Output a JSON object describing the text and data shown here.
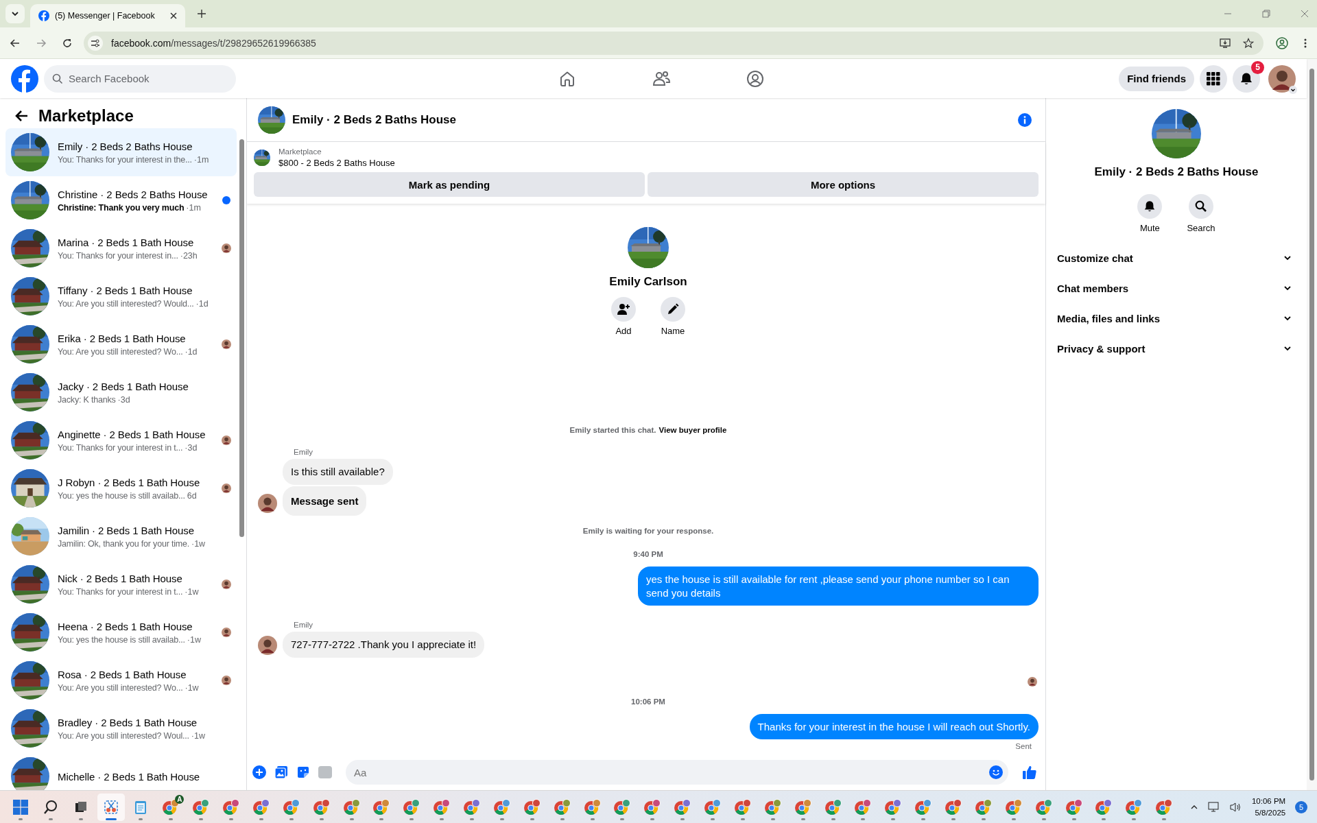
{
  "browser": {
    "tab_title": "(5) Messenger | Facebook",
    "url_host": "facebook.com",
    "url_path": "/messages/t/29829652619966385"
  },
  "topnav": {
    "search_placeholder": "Search Facebook",
    "find_friends": "Find friends",
    "notification_count": "5"
  },
  "sidebar": {
    "title": "Marketplace",
    "conversations": [
      {
        "title": "Emily · 2 Beds 2 Baths House",
        "preview": "You: Thanks for your interest in the...",
        "time": "·1m",
        "selected": true,
        "unread": false,
        "seen": false
      },
      {
        "title": "Christine · 2 Beds 2 Baths House",
        "preview": "Christine: Thank you very much",
        "time": "·1m",
        "selected": false,
        "unread": true,
        "seen": false
      },
      {
        "title": "Marina · 2 Beds 1 Bath House",
        "preview": "You: Thanks for your interest in...",
        "time": "·23h",
        "selected": false,
        "unread": false,
        "seen": true
      },
      {
        "title": "Tiffany · 2 Beds 1 Bath House",
        "preview": "You: Are you still interested? Would...",
        "time": "·1d",
        "selected": false,
        "unread": false,
        "seen": false
      },
      {
        "title": "Erika · 2 Beds 1 Bath House",
        "preview": "You: Are you still interested? Wo...",
        "time": "·1d",
        "selected": false,
        "unread": false,
        "seen": true
      },
      {
        "title": "Jacky · 2 Beds 1 Bath House",
        "preview": "Jacky: K thanks",
        "time": "·3d",
        "selected": false,
        "unread": false,
        "seen": false
      },
      {
        "title": "Anginette · 2 Beds 1 Bath House",
        "preview": "You: Thanks for your interest in t...",
        "time": "·3d",
        "selected": false,
        "unread": false,
        "seen": true
      },
      {
        "title": "J Robyn · 2 Beds 1 Bath House",
        "preview": "You: yes the house is still availab...",
        "time": "6d",
        "selected": false,
        "unread": false,
        "seen": true
      },
      {
        "title": "Jamilin · 2 Beds 1 Bath House",
        "preview": "Jamilin: Ok, thank you for your time.",
        "time": "·1w",
        "selected": false,
        "unread": false,
        "seen": false
      },
      {
        "title": "Nick · 2 Beds 1 Bath House",
        "preview": "You: Thanks for your interest in t...",
        "time": "·1w",
        "selected": false,
        "unread": false,
        "seen": true
      },
      {
        "title": "Heena · 2 Beds 1 Bath House",
        "preview": "You: yes the house is still availab...",
        "time": "·1w",
        "selected": false,
        "unread": false,
        "seen": true
      },
      {
        "title": "Rosa · 2 Beds 1 Bath House",
        "preview": "You: Are you still interested? Wo...",
        "time": "·1w",
        "selected": false,
        "unread": false,
        "seen": true
      },
      {
        "title": "Bradley · 2 Beds 1 Bath House",
        "preview": "You: Are you still interested? Woul...",
        "time": "·1w",
        "selected": false,
        "unread": false,
        "seen": false
      },
      {
        "title": "Michelle · 2 Beds 1 Bath House",
        "selected": false,
        "unread": false,
        "seen": false
      }
    ]
  },
  "chat": {
    "title": "Emily · 2 Beds 2 Baths House",
    "listing": {
      "label": "Marketplace",
      "item": "$800 - 2 Beds 2 Baths House"
    },
    "actions": [
      "Mark as pending",
      "More options"
    ],
    "profile": {
      "name": "Emily Carlson",
      "buttons": [
        {
          "kind": "add",
          "label": "Add"
        },
        {
          "kind": "rename",
          "label": "Name"
        }
      ]
    },
    "messages": [
      {
        "kind": "system",
        "text": "Emily started this chat.",
        "link": "View buyer profile"
      },
      {
        "kind": "sender",
        "text": "Emily"
      },
      {
        "kind": "incoming",
        "text": "Is this still available?",
        "avatar": false,
        "bold": false
      },
      {
        "kind": "incoming",
        "text": "Message sent",
        "avatar": true,
        "bold": true
      },
      {
        "kind": "system",
        "text": "Emily is waiting for your response."
      },
      {
        "kind": "time",
        "text": "9:40 PM"
      },
      {
        "kind": "outgoing",
        "text": "yes the house is still available for rent ,please send your phone number so I can send you details"
      },
      {
        "kind": "sender",
        "text": "Emily"
      },
      {
        "kind": "incoming",
        "text": "727-777-2722 .Thank you I appreciate it!",
        "avatar": true,
        "bold": false
      },
      {
        "kind": "seen"
      },
      {
        "kind": "time",
        "text": "10:06 PM"
      },
      {
        "kind": "outgoing",
        "text": "Thanks for your interest in the house I will reach out Shortly."
      },
      {
        "kind": "status",
        "text": "Sent"
      }
    ],
    "composer": {
      "placeholder": "Aa"
    }
  },
  "details": {
    "title": "Emily · 2 Beds 2 Baths House",
    "buttons": [
      {
        "kind": "mute",
        "label": "Mute"
      },
      {
        "kind": "search",
        "label": "Search"
      }
    ],
    "sections": [
      {
        "label": "Customize chat",
        "expanded": false
      },
      {
        "label": "Chat members",
        "expanded": false
      },
      {
        "label": "Media, files and links",
        "expanded": false
      },
      {
        "label": "Privacy & support",
        "expanded": false
      }
    ]
  },
  "taskbar": {
    "apps": [
      {
        "kind": "start",
        "selected": false
      },
      {
        "kind": "search",
        "selected": false
      },
      {
        "kind": "task-view",
        "selected": false
      },
      {
        "kind": "snipping",
        "selected": true
      },
      {
        "kind": "notepad",
        "selected": false
      },
      {
        "kind": "browser",
        "badge": "A",
        "selected": false
      },
      {
        "kind": "browser",
        "selected": false
      },
      {
        "kind": "browser",
        "selected": false
      },
      {
        "kind": "browser",
        "selected": false
      },
      {
        "kind": "browser",
        "selected": false
      },
      {
        "kind": "browser",
        "selected": false
      },
      {
        "kind": "browser",
        "selected": false
      },
      {
        "kind": "browser",
        "selected": false
      },
      {
        "kind": "browser",
        "selected": false
      },
      {
        "kind": "browser",
        "selected": false
      },
      {
        "kind": "browser",
        "selected": false
      },
      {
        "kind": "browser",
        "selected": false
      },
      {
        "kind": "browser",
        "selected": false
      },
      {
        "kind": "browser",
        "selected": false
      },
      {
        "kind": "browser",
        "selected": false
      },
      {
        "kind": "browser",
        "selected": false
      },
      {
        "kind": "browser",
        "selected": false
      },
      {
        "kind": "browser",
        "selected": false
      },
      {
        "kind": "browser",
        "selected": false
      },
      {
        "kind": "browser",
        "selected": false
      },
      {
        "kind": "browser",
        "selected": false
      },
      {
        "kind": "browser",
        "selected": false
      },
      {
        "kind": "browser",
        "selected": false
      },
      {
        "kind": "browser",
        "selected": false
      },
      {
        "kind": "browser",
        "selected": false
      },
      {
        "kind": "browser",
        "selected": false
      },
      {
        "kind": "browser",
        "selected": false
      },
      {
        "kind": "browser",
        "selected": false
      },
      {
        "kind": "browser",
        "selected": false
      },
      {
        "kind": "browser",
        "selected": false
      },
      {
        "kind": "browser",
        "selected": false
      },
      {
        "kind": "browser",
        "selected": false
      },
      {
        "kind": "browser",
        "selected": false
      },
      {
        "kind": "browser",
        "selected": false
      }
    ],
    "time": "10:06 PM",
    "date": "5/8/2025",
    "notifications": "5"
  }
}
